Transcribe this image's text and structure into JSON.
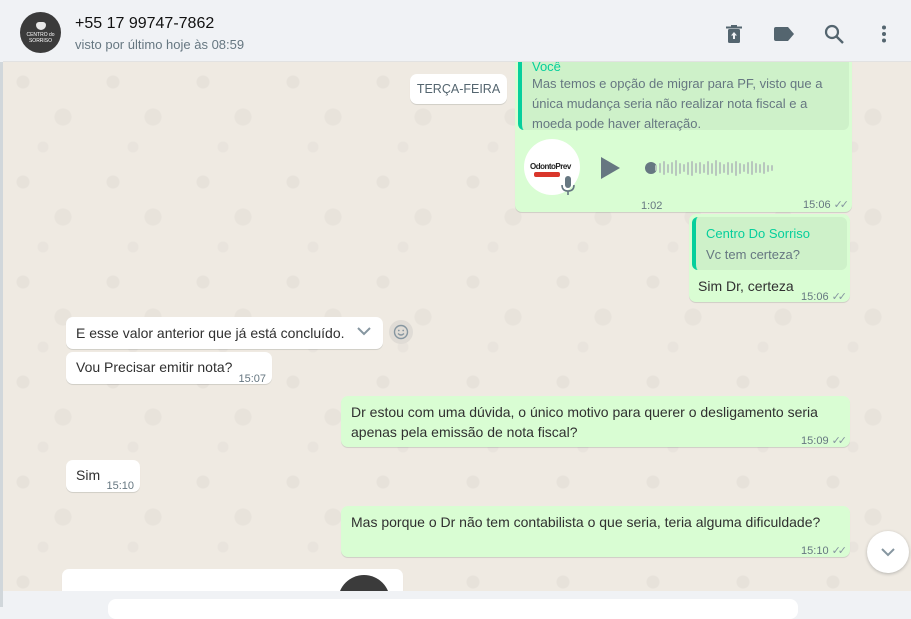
{
  "header": {
    "avatar_text_top": "CENTRO do",
    "avatar_text_bottom": "SORRISO",
    "contact_name": "+55 17 99747-7862",
    "status": "visto por último hoje às 08:59",
    "icons": [
      "delete-icon",
      "label-icon",
      "search-icon",
      "menu-icon"
    ]
  },
  "chat": {
    "date_chip": "TERÇA-FEIRA",
    "messages": {
      "quoted_reply": {
        "author": "Você",
        "line1": "Mas temos e opção de migrar para PF, visto que a",
        "line2": "única mudança seria não realizar nota fiscal e a",
        "line3": "moeda pode haver alteração."
      },
      "voice": {
        "logo_text": "OdontoPrev",
        "duration": "1:02",
        "time": "15:06"
      },
      "reply_certeza": {
        "quote_author": "Centro Do Sorriso",
        "quote_text": "Vc tem certeza?",
        "text": "Sim Dr, certeza",
        "time": "15:06"
      },
      "in1": {
        "text": "E esse valor anterior que já está concluído."
      },
      "in2": {
        "text": "Vou Precisar emitir nota?",
        "time": "15:07"
      },
      "out_duvida": {
        "line1": "Dr estou com uma dúvida, o único motivo para querer o desligamento seria",
        "line2": "apenas pela emissão de nota fiscal?",
        "time": "15:09"
      },
      "in_sim": {
        "text": "Sim",
        "time": "15:10"
      },
      "out_contabilista": {
        "text": "Mas porque o Dr não tem contabilista o que seria, teria alguma dificuldade?",
        "time": "15:10"
      }
    },
    "tick": "✓✓"
  },
  "colors": {
    "outgoing": "#d9fdd3",
    "incoming": "#ffffff",
    "accent": "#06cf9c",
    "chat_bg": "#efeae2"
  }
}
